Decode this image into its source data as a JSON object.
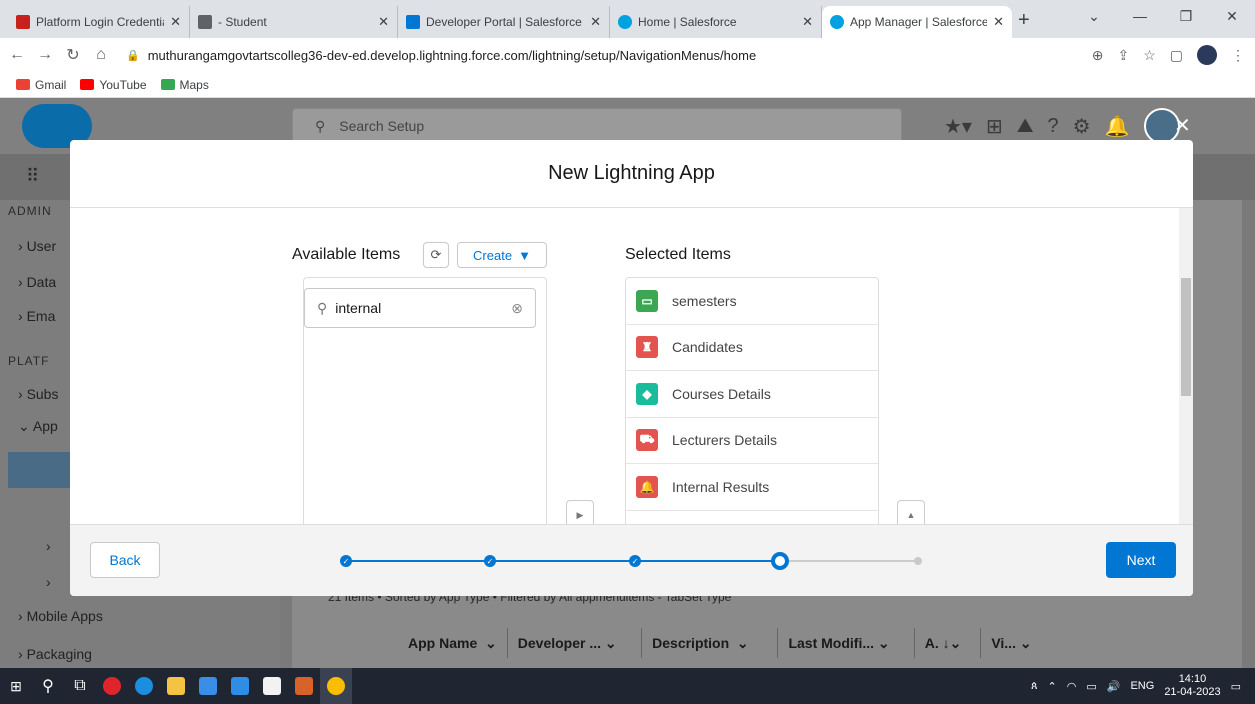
{
  "browser": {
    "tabs": [
      {
        "title": "Platform Login Credentials - ",
        "color": "#c5221f"
      },
      {
        "title": " - Student",
        "color": "#5f6368"
      },
      {
        "title": "Developer Portal | Salesforce",
        "color": "#0176d3"
      },
      {
        "title": "Home | Salesforce",
        "color": "#00a1e0"
      },
      {
        "title": "App Manager | Salesforce",
        "color": "#00a1e0"
      }
    ],
    "url": "muthurangamgovtartscolleg36-dev-ed.develop.lightning.force.com/lightning/setup/NavigationMenus/home",
    "bookmarks": [
      "Gmail",
      "YouTube",
      "Maps"
    ]
  },
  "salesforce": {
    "search_placeholder": "Search Setup",
    "sidebar": {
      "admin_label": "ADMIN",
      "items_top": [
        "User",
        "Data",
        "Ema"
      ],
      "platform_label": "PLATF",
      "items_mid": [
        "Subs",
        "App"
      ],
      "items_bottom": [
        "Mobile Apps",
        "Packaging"
      ]
    },
    "list_info": "21 Items • Sorted by App Type • Filtered by All appmenuitems - TabSet Type",
    "columns": [
      "App Name",
      "Developer ...",
      "Description",
      "Last Modifi...",
      "A.",
      "Vi..."
    ]
  },
  "modal": {
    "title": "New Lightning App",
    "available_label": "Available Items",
    "create_label": "Create",
    "search_value": "internal",
    "selected_label": "Selected Items",
    "selected_items": [
      {
        "label": "semesters",
        "color": "#3ba755"
      },
      {
        "label": "Candidates",
        "color": "#e3534f"
      },
      {
        "label": "Courses Details",
        "color": "#1bbc9b"
      },
      {
        "label": "Lecturers Details",
        "color": "#e3534f"
      },
      {
        "label": "Internal Results",
        "color": "#e3534f"
      }
    ],
    "back_label": "Back",
    "next_label": "Next",
    "progress": {
      "total_steps": 5,
      "completed_steps": 3,
      "current_step": 4
    }
  },
  "taskbar": {
    "lang": "ENG",
    "time": "14:10",
    "date": "21-04-2023"
  }
}
